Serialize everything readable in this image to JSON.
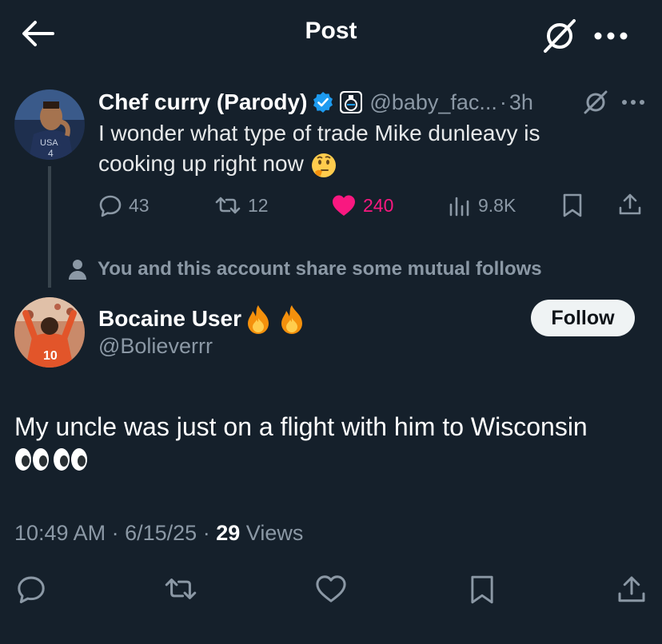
{
  "header": {
    "title": "Post"
  },
  "parent_post": {
    "author_name": "Chef curry (Parody)",
    "handle": "@baby_fac...",
    "separator": "·",
    "time": "3h",
    "text": "I wonder what type of trade Mike dunleavy is cooking up right now",
    "stats": {
      "replies": "43",
      "reposts": "12",
      "likes": "240",
      "views": "9.8K"
    }
  },
  "mutual_notice": "You and this account share some mutual follows",
  "post": {
    "author_name": "Bocaine User",
    "handle": "@Bolieverrr",
    "follow_label": "Follow",
    "text": "My uncle was just on a flight with him to Wisconsin",
    "time": "10:49 AM",
    "date": "6/15/25",
    "sep": "·",
    "views_count": "29",
    "views_label": "Views"
  },
  "colors": {
    "background": "#15202b",
    "like": "#f91880",
    "verified": "#1d9bf0",
    "muted": "#8b98a5"
  },
  "icons": [
    "back-arrow-icon",
    "grok-icon",
    "more-icon",
    "verified-icon",
    "affiliate-badge-icon",
    "reply-icon",
    "repost-icon",
    "like-icon",
    "views-icon",
    "bookmark-icon",
    "share-icon",
    "person-icon",
    "fire-emoji",
    "eyes-emoji",
    "thinking-emoji"
  ]
}
